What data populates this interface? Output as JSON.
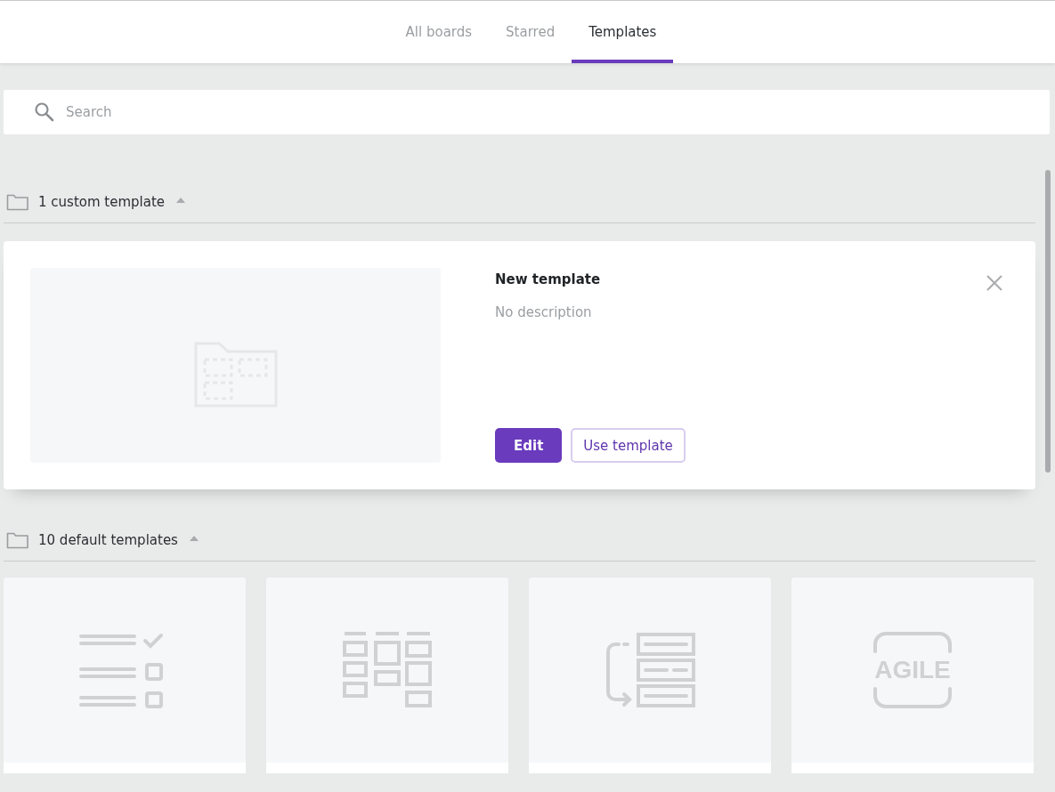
{
  "tabs": [
    {
      "label": "All boards",
      "selected": false
    },
    {
      "label": "Starred",
      "selected": false
    },
    {
      "label": "Templates",
      "selected": true
    }
  ],
  "search": {
    "placeholder": "Search"
  },
  "custom_section": {
    "title": "1 custom template",
    "expanded": true,
    "templates": [
      {
        "title": "New template",
        "description": "No description",
        "buttons": [
          {
            "label": "Edit",
            "kind": "primary"
          },
          {
            "label": "Use template",
            "kind": "secondary"
          }
        ]
      }
    ]
  },
  "default_section": {
    "title": "10 default templates",
    "expanded": true,
    "templates": [
      {
        "kind": "checklist"
      },
      {
        "kind": "kanban"
      },
      {
        "kind": "process"
      },
      {
        "kind": "agile",
        "badge": "AGILE"
      }
    ]
  }
}
